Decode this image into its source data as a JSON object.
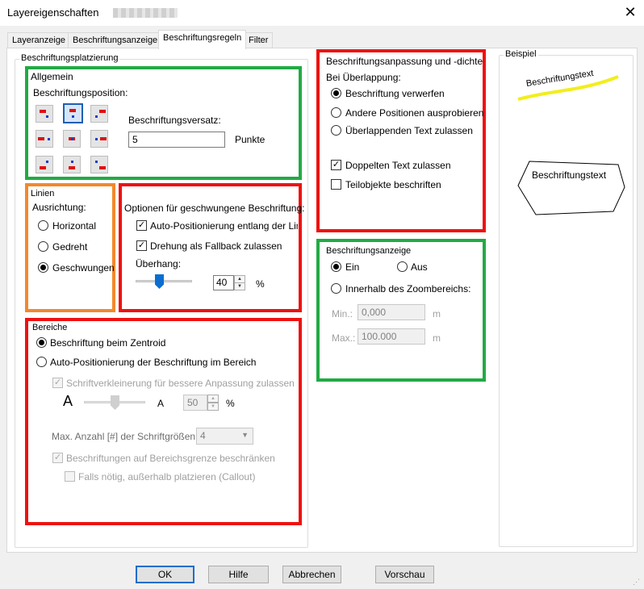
{
  "window": {
    "title": "Layereigenschaften"
  },
  "tabs": [
    {
      "label": "Layeranzeige"
    },
    {
      "label": "Beschriftungsanzeige"
    },
    {
      "label": "Beschriftungsregeln"
    },
    {
      "label": "Filter"
    }
  ],
  "placement": {
    "title": "Beschriftungsplatzierung",
    "general": {
      "title": "Allgemein",
      "position_label": "Beschriftungsposition:",
      "offset_label": "Beschriftungsversatz:",
      "offset_value": "5",
      "offset_unit": "Punkte"
    },
    "lines": {
      "title": "Linien",
      "alignment_label": "Ausrichtung:",
      "options": [
        {
          "label": "Horizontal",
          "selected": false
        },
        {
          "label": "Gedreht",
          "selected": false
        },
        {
          "label": "Geschwungen",
          "selected": true
        }
      ]
    },
    "curved": {
      "title": "Optionen für geschwungene Beschriftung:",
      "auto_position_label": "Auto-Positionierung entlang der Linie",
      "rotation_fallback_label": "Drehung als Fallback zulassen",
      "overhang_label": "Überhang:",
      "overhang_value": "40",
      "overhang_unit": "%"
    },
    "areas": {
      "title": "Bereiche",
      "centroid_label": "Beschriftung beim Zentroid",
      "auto_area_label": "Auto-Positionierung der Beschriftung im Bereich",
      "shrink_label": "Schriftverkleinerung für bessere Anpassung zulassen",
      "big_a": "A",
      "small_a": "A",
      "shrink_value": "50",
      "shrink_unit": "%",
      "max_fonts_label": "Max. Anzahl [#] der Schriftgrößen:",
      "max_fonts_value": "4",
      "restrict_label": "Beschriftungen auf Bereichsgrenze beschränken",
      "callout_label": "Falls nötig, außerhalb platzieren (Callout)"
    }
  },
  "density": {
    "title": "Beschriftungsanpassung und -dichte",
    "overlap_label": "Bei Überlappung:",
    "options": [
      {
        "label": "Beschriftung verwerfen",
        "selected": true
      },
      {
        "label": "Andere Positionen ausprobieren",
        "selected": false
      },
      {
        "label": "Überlappenden Text zulassen",
        "selected": false
      }
    ],
    "duplicate_label": "Doppelten Text zulassen",
    "duplicate_checked": true,
    "subobjects_label": "Teilobjekte beschriften",
    "subobjects_checked": false
  },
  "display": {
    "title": "Beschriftungsanzeige",
    "on_label": "Ein",
    "off_label": "Aus",
    "zoom_label": "Innerhalb des Zoombereichs:",
    "min_label": "Min.:",
    "min_value": "0,000",
    "max_label": "Max.:",
    "max_value": "100.000",
    "unit": "m"
  },
  "example": {
    "title": "Beispiel",
    "curved_text": "Beschriftungstext",
    "area_text": "Beschriftungstext"
  },
  "buttons": {
    "ok": "OK",
    "help": "Hilfe",
    "cancel": "Abbrechen",
    "preview": "Vorschau"
  },
  "colors": {
    "highlight_red": "#ee1111",
    "highlight_green": "#22aa44",
    "highlight_orange": "#f3882d",
    "selection_blue": "#1e5fb4"
  }
}
